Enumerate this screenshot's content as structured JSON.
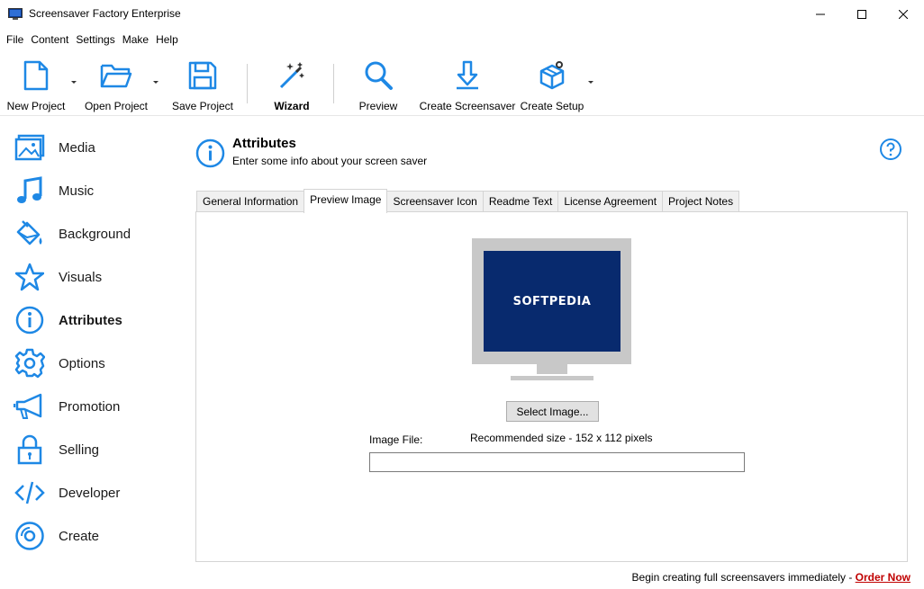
{
  "window": {
    "title": "Screensaver Factory Enterprise"
  },
  "menu": [
    "File",
    "Content",
    "Settings",
    "Make",
    "Help"
  ],
  "toolbar": {
    "new_project": "New Project",
    "open_project": "Open Project",
    "save_project": "Save Project",
    "wizard": "Wizard",
    "preview": "Preview",
    "create_screensaver": "Create Screensaver",
    "create_setup": "Create Setup"
  },
  "sidebar": {
    "items": [
      {
        "label": "Media",
        "icon": "image-icon"
      },
      {
        "label": "Music",
        "icon": "music-note-icon"
      },
      {
        "label": "Background",
        "icon": "paint-bucket-icon"
      },
      {
        "label": "Visuals",
        "icon": "star-icon"
      },
      {
        "label": "Attributes",
        "icon": "info-icon",
        "active": true
      },
      {
        "label": "Options",
        "icon": "gear-icon"
      },
      {
        "label": "Promotion",
        "icon": "megaphone-icon"
      },
      {
        "label": "Selling",
        "icon": "lock-icon"
      },
      {
        "label": "Developer",
        "icon": "code-icon"
      },
      {
        "label": "Create",
        "icon": "disc-icon"
      }
    ]
  },
  "header": {
    "title": "Attributes",
    "subtitle": "Enter some info about your screen saver"
  },
  "tabs": [
    {
      "label": "General Information"
    },
    {
      "label": "Preview Image",
      "active": true
    },
    {
      "label": "Screensaver Icon"
    },
    {
      "label": "Readme Text"
    },
    {
      "label": "License Agreement"
    },
    {
      "label": "Project Notes"
    }
  ],
  "preview": {
    "screen_logo": "SOFTPEDIA",
    "select_button": "Select Image...",
    "image_file_label": "Image File:",
    "recommended_size": "Recommended size - 152 x 112 pixels",
    "image_file_value": ""
  },
  "footer": {
    "text": "Begin creating full screensavers immediately - ",
    "link": "Order Now"
  },
  "colors": {
    "accent_blue": "#1e88e5",
    "screen_bg": "#082a6e",
    "link_red": "#c00000"
  }
}
